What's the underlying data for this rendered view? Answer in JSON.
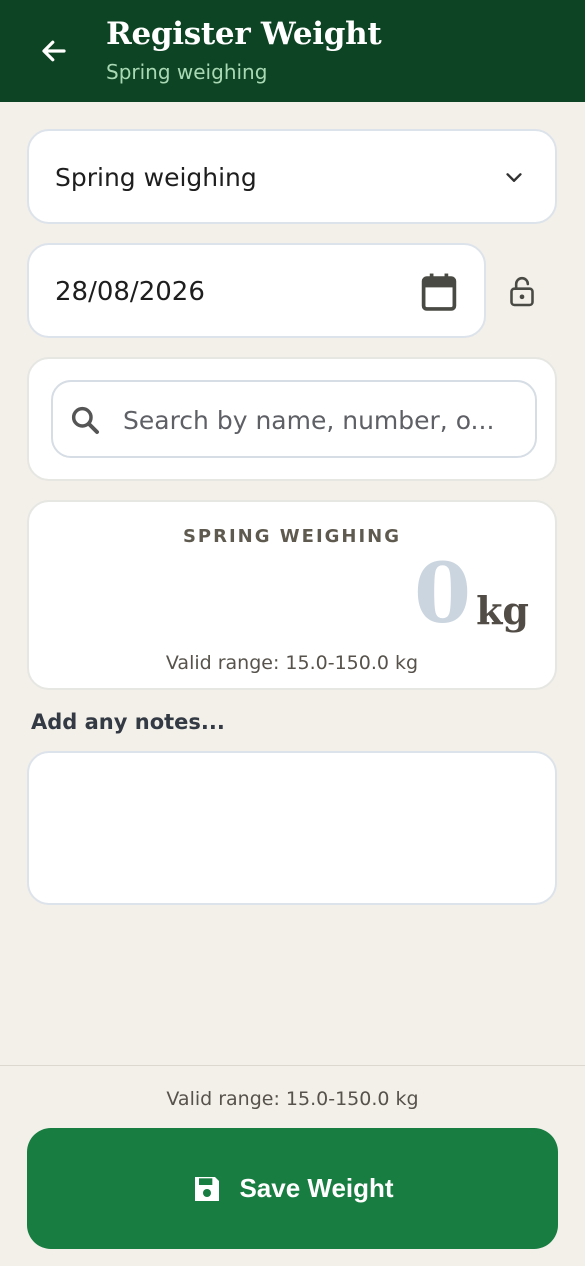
{
  "header": {
    "title": "Register Weight",
    "subtitle": "Spring weighing",
    "back_icon": "arrow-left-icon"
  },
  "event_select": {
    "selected": "Spring weighing",
    "icon": "chevron-down-icon"
  },
  "date": {
    "value": "28/08/2026",
    "icon": "calendar-icon",
    "lock_icon": "lock-open-icon"
  },
  "search": {
    "placeholder": "Search by name, number, o...",
    "icon": "search-icon"
  },
  "weight": {
    "label": "SPRING WEIGHING",
    "value": "0",
    "unit": "kg",
    "valid_range": "Valid range: 15.0-150.0 kg"
  },
  "notes": {
    "label": "Add any notes...",
    "value": ""
  },
  "footer": {
    "valid_range": "Valid range: 15.0-150.0 kg",
    "save_label": "Save Weight",
    "save_icon": "floppy-disk-icon"
  },
  "colors": {
    "header_bg": "#0d4423",
    "subtitle": "#a9d8b4",
    "button_bg": "#177d41",
    "page_bg": "#f3f0ea",
    "weight_placeholder": "#cbd5df"
  }
}
